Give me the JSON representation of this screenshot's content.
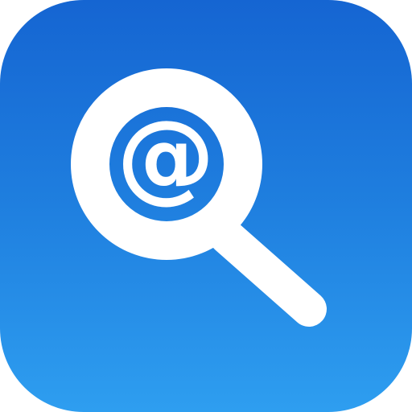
{
  "icon": {
    "symbol": "@",
    "colors": {
      "gradient_top": "#1565d2",
      "gradient_bottom": "#2e9ef0",
      "glyph": "#ffffff"
    },
    "glyph_icon": "magnifying-glass-icon",
    "inner_symbol_icon": "at-sign-icon"
  }
}
